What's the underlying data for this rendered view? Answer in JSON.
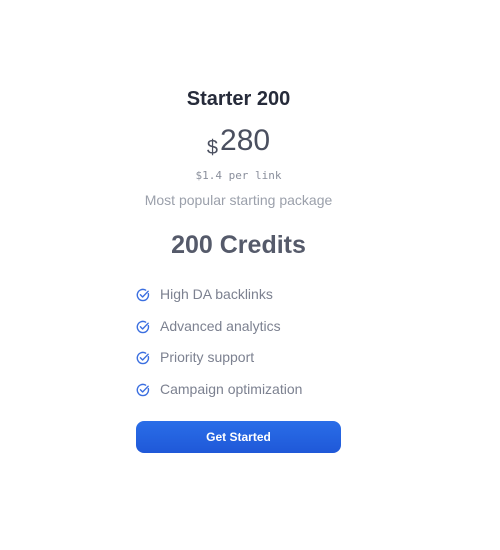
{
  "plan": {
    "title": "Starter 200",
    "price": {
      "currency": "$",
      "amount": "280"
    },
    "per_link": "$1.4 per link",
    "tagline": "Most popular starting package",
    "credits": "200 Credits",
    "features": [
      {
        "label": "High DA backlinks",
        "icon": "check-circle-icon"
      },
      {
        "label": "Advanced analytics",
        "icon": "check-circle-icon"
      },
      {
        "label": "Priority support",
        "icon": "check-circle-icon"
      },
      {
        "label": "Campaign optimization",
        "icon": "check-circle-icon"
      }
    ],
    "cta_label": "Get Started"
  },
  "colors": {
    "accent": "#2563eb",
    "check": "#3b6fe0",
    "title": "#262b3a",
    "muted": "#9ba0ab"
  }
}
